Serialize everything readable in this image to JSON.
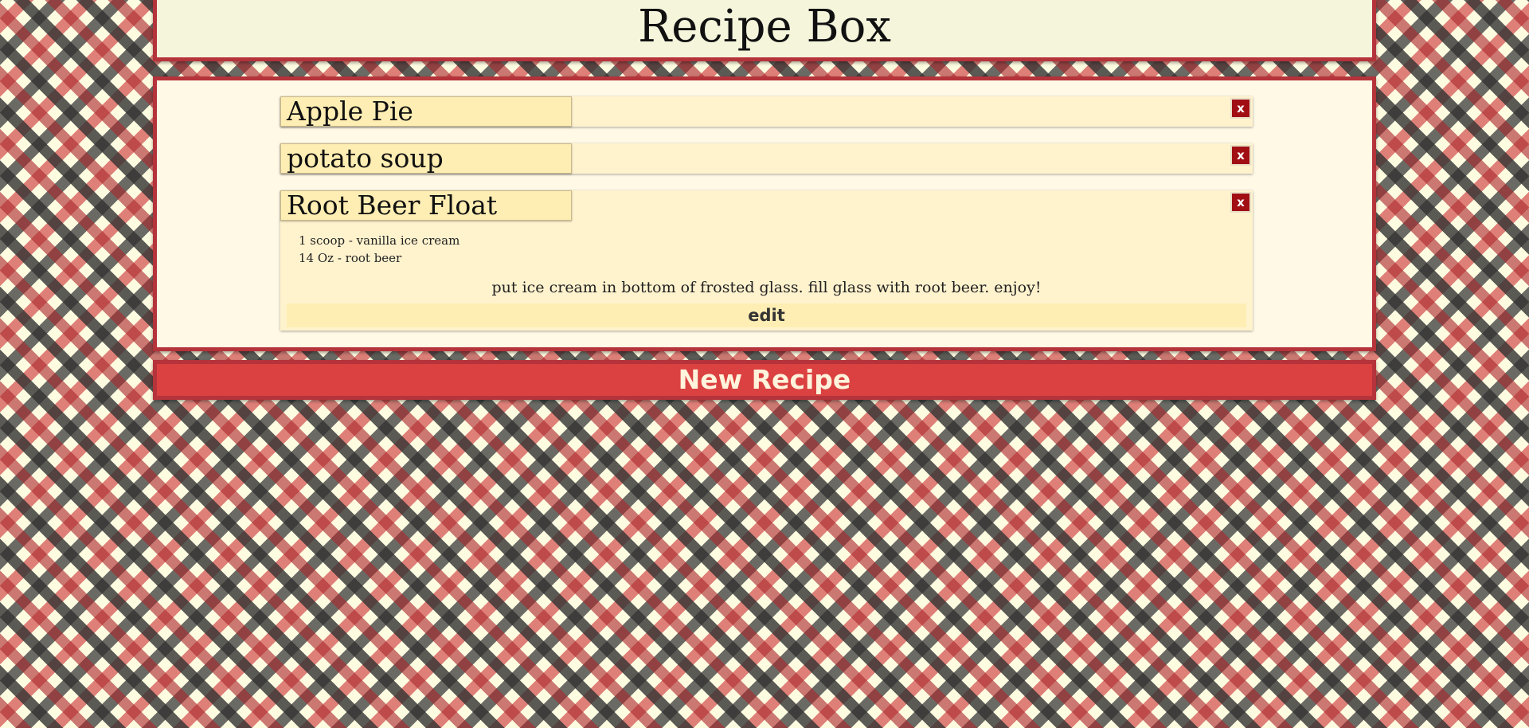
{
  "header": {
    "title": "Recipe Box"
  },
  "recipes": [
    {
      "name": "Apple Pie",
      "delete_label": "x",
      "expanded": false
    },
    {
      "name": "potato soup",
      "delete_label": "x",
      "expanded": false
    },
    {
      "name": "Root Beer Float",
      "delete_label": "x",
      "expanded": true,
      "ingredients": [
        "1 scoop - vanilla ice cream",
        "14 Oz - root beer"
      ],
      "directions": "put ice cream in bottom of frosted glass. fill glass with root beer. enjoy!",
      "edit_label": "edit"
    }
  ],
  "actions": {
    "new_recipe_label": "New Recipe"
  },
  "colors": {
    "accent_border": "#b5333a",
    "delete_button": "#a10e14",
    "new_recipe_button": "#db4141",
    "title_tab": "#ffeeb3",
    "panel_background": "#fff9e6"
  }
}
